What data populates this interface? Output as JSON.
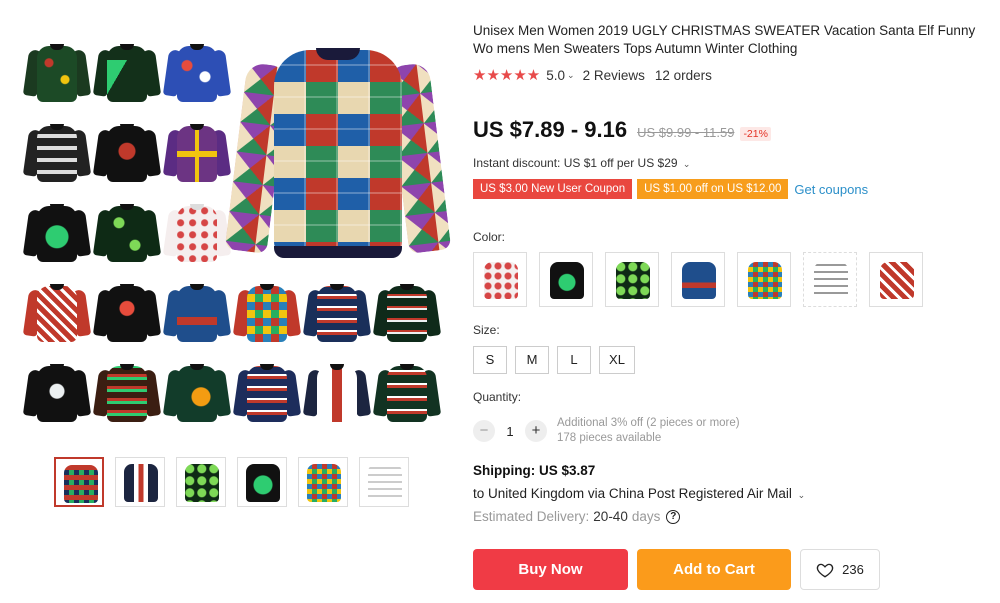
{
  "product": {
    "title": "Unisex Men Women 2019 UGLY CHRISTMAS SWEATER Vacation Santa Elf Funny Wo mens Men Sweaters Tops Autumn Winter Clothing",
    "stars": "★★★★★",
    "rating": "5.0",
    "reviews": "2 Reviews",
    "orders": "12 orders"
  },
  "price": {
    "current": "US $7.89 - 9.16",
    "original": "US $9.99 - 11.59",
    "discount": "-21%"
  },
  "promo": {
    "instant_discount": "Instant discount: US $1 off per US $29",
    "coupon_new_user": "US $3.00 New User Coupon",
    "coupon_off": "US $1.00 off on US $12.00",
    "get_coupons": "Get coupons"
  },
  "options": {
    "color_label": "Color:",
    "size_label": "Size:",
    "sizes": [
      "S",
      "M",
      "L",
      "XL"
    ]
  },
  "quantity": {
    "label": "Quantity:",
    "minus": "−",
    "value": "1",
    "plus": "+",
    "note_line1": "Additional 3% off (2 pieces or more)",
    "note_line2": "178 pieces available"
  },
  "shipping": {
    "cost": "Shipping: US $3.87",
    "to": "to United Kingdom via China Post Registered Air Mail",
    "delivery_label": "Estimated Delivery:",
    "delivery_days": "20-40",
    "delivery_unit": "days"
  },
  "actions": {
    "buy_now": "Buy Now",
    "add_to_cart": "Add to Cart",
    "wishlist_count": "236"
  },
  "colors": {
    "accent_red": "#f03b45",
    "accent_orange": "#fb9b1b",
    "star_red": "#e84a4a",
    "link_blue": "#2b8fc9"
  }
}
